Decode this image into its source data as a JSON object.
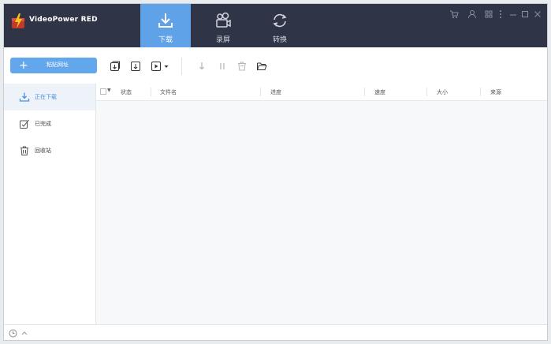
{
  "app": {
    "title": "VideoPower RED"
  },
  "tabs": [
    {
      "label": "下载",
      "icon": "download-icon",
      "active": true
    },
    {
      "label": "录屏",
      "icon": "camera-icon",
      "active": false
    },
    {
      "label": "转换",
      "icon": "convert-icon",
      "active": false
    }
  ],
  "window_controls": [
    "cart-icon",
    "user-icon",
    "grid-icon",
    "menu-icon",
    "minimize-icon",
    "maximize-icon",
    "close-icon"
  ],
  "toolbar": {
    "paste_label": "粘贴网址",
    "buttons": [
      "add-download-icon",
      "download-file-icon",
      "video-play-icon",
      "resume-icon",
      "pause-icon",
      "delete-icon",
      "folder-icon"
    ]
  },
  "sidebar": {
    "items": [
      {
        "label": "正在下载",
        "icon": "download-icon",
        "active": true
      },
      {
        "label": "已完成",
        "icon": "completed-icon",
        "active": false
      },
      {
        "label": "回收站",
        "icon": "trash-icon",
        "active": false
      }
    ]
  },
  "table": {
    "columns": [
      "状态",
      "文件名",
      "进度",
      "速度",
      "大小",
      "来源"
    ],
    "rows": []
  },
  "colors": {
    "titlebar": "#2f3446",
    "accent": "#5fa2e8"
  }
}
